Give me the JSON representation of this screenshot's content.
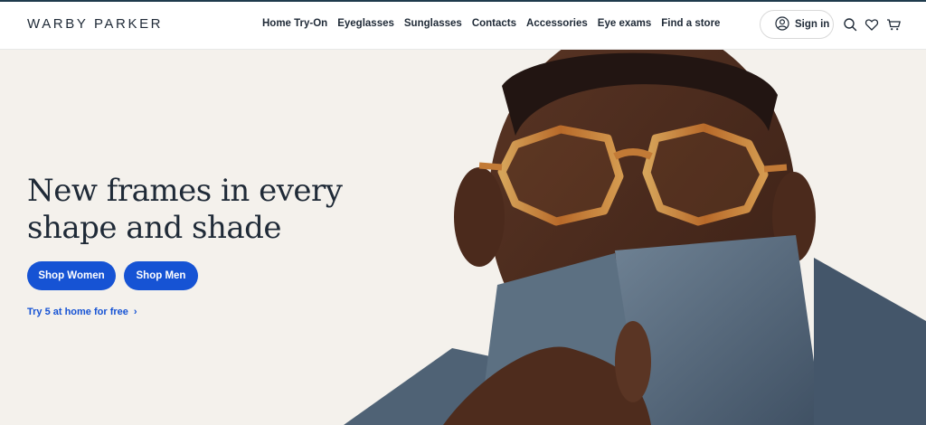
{
  "brand": {
    "logo": "WARBY PARKER"
  },
  "nav": {
    "items": [
      "Home Try-On",
      "Eyeglasses",
      "Sunglasses",
      "Contacts",
      "Accessories",
      "Eye exams",
      "Find a store"
    ]
  },
  "header": {
    "signin_label": "Sign in",
    "icons": [
      "user-icon",
      "search-icon",
      "heart-icon",
      "cart-icon"
    ]
  },
  "hero": {
    "headline_line1": "New frames in every",
    "headline_line2": "shape and shade",
    "shop_women": "Shop Women",
    "shop_men": "Shop Men",
    "try_link": "Try 5 at home for free",
    "try_chevron": "›"
  },
  "colors": {
    "accent": "#1653d4",
    "hero_bg": "#f4f1ec",
    "text": "#1f2a37"
  }
}
